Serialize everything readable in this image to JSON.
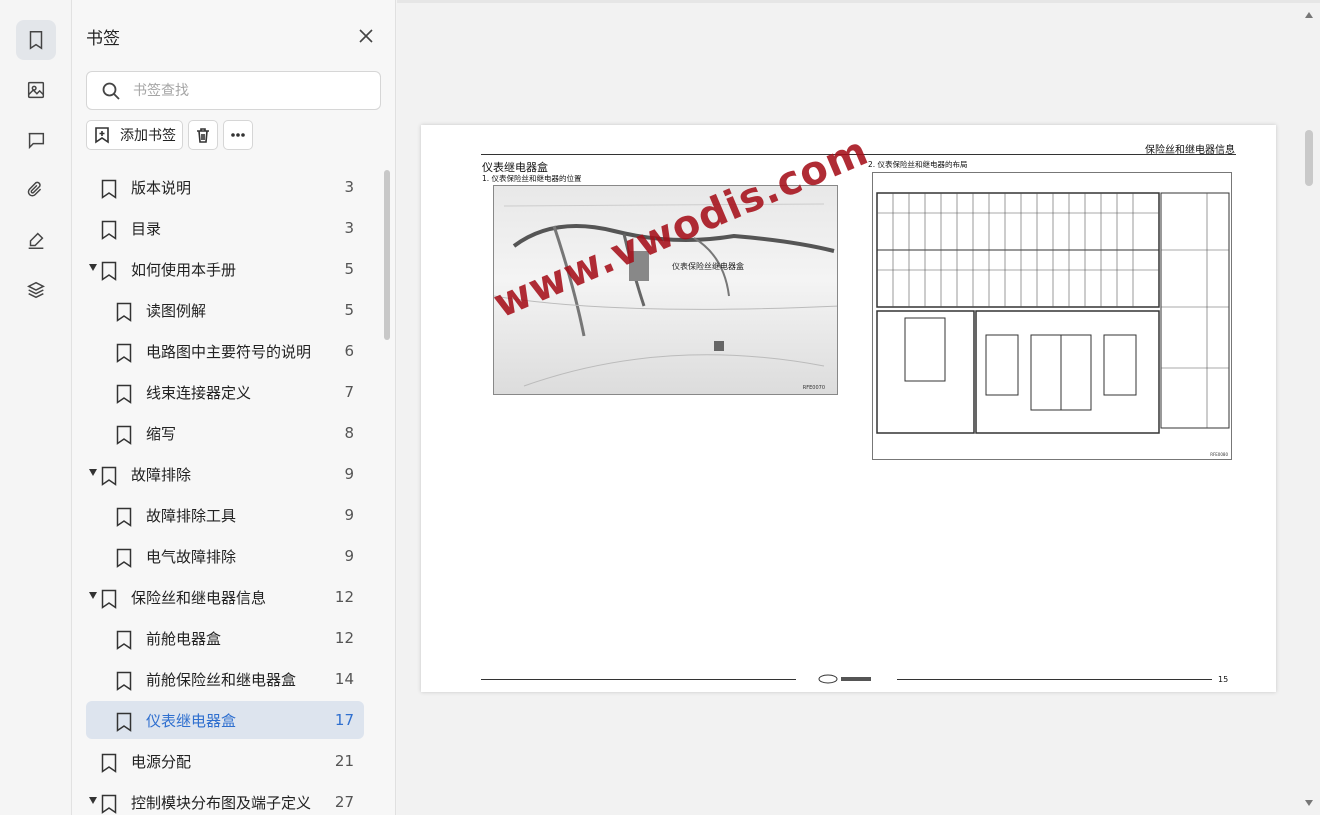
{
  "panel": {
    "title": "书签",
    "search_placeholder": "书签查找",
    "add_label": "添加书签"
  },
  "rail": {
    "icons": [
      "bookmark-icon",
      "image-icon",
      "comment-icon",
      "attachment-icon",
      "signature-icon",
      "layers-icon"
    ]
  },
  "bookmarks": [
    {
      "label": "版本说明",
      "page": "3",
      "level": 0,
      "expanded": false
    },
    {
      "label": "目录",
      "page": "3",
      "level": 0,
      "expanded": false
    },
    {
      "label": "如何使用本手册",
      "page": "5",
      "level": 0,
      "expanded": true
    },
    {
      "label": "读图例解",
      "page": "5",
      "level": 1,
      "expanded": false
    },
    {
      "label": "电路图中主要符号的说明",
      "page": "6",
      "level": 1,
      "expanded": false
    },
    {
      "label": "线束连接器定义",
      "page": "7",
      "level": 1,
      "expanded": false
    },
    {
      "label": "缩写",
      "page": "8",
      "level": 1,
      "expanded": false
    },
    {
      "label": "故障排除",
      "page": "9",
      "level": 0,
      "expanded": true
    },
    {
      "label": "故障排除工具",
      "page": "9",
      "level": 1,
      "expanded": false
    },
    {
      "label": "电气故障排除",
      "page": "9",
      "level": 1,
      "expanded": false
    },
    {
      "label": "保险丝和继电器信息",
      "page": "12",
      "level": 0,
      "expanded": true
    },
    {
      "label": "前舱电器盒",
      "page": "12",
      "level": 1,
      "expanded": false
    },
    {
      "label": "前舱保险丝和继电器盒",
      "page": "14",
      "level": 1,
      "expanded": false
    },
    {
      "label": "仪表继电器盒",
      "page": "17",
      "level": 1,
      "expanded": false,
      "selected": true
    },
    {
      "label": "电源分配",
      "page": "21",
      "level": 0,
      "expanded": false
    },
    {
      "label": "控制模块分布图及端子定义",
      "page": "27",
      "level": 0,
      "expanded": true
    }
  ],
  "document": {
    "header_title": "保险丝和继电器信息",
    "section_title": "仪表继电器盒",
    "sub1": "1. 仪表保险丝和继电器的位置",
    "sub2": "2. 仪表保险丝和继电器的布局",
    "photo_label": "仪表保险丝继电器盒",
    "photo_code": "RFE0070",
    "diagram_code": "RFE0080",
    "watermark": "www.vwodis.com",
    "page_number": "15"
  },
  "colors": {
    "selected_text": "#2f6fcf",
    "selected_bg": "#dde4ee",
    "watermark": "#a50f19"
  }
}
